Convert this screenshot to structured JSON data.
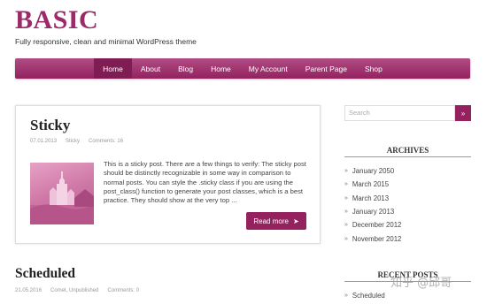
{
  "site": {
    "title": "BASIC",
    "tagline": "Fully responsive, clean and minimal WordPress theme"
  },
  "nav": {
    "items": [
      {
        "label": "Home",
        "active": true
      },
      {
        "label": "About",
        "active": false
      },
      {
        "label": "Blog",
        "active": false
      },
      {
        "label": "Home",
        "active": false
      },
      {
        "label": "My Account",
        "active": false
      },
      {
        "label": "Parent Page",
        "active": false
      },
      {
        "label": "Shop",
        "active": false
      }
    ]
  },
  "post1": {
    "title": "Sticky",
    "date": "07.01.2013",
    "category": "Sticky",
    "comments": "Comments: 16",
    "excerpt": "This is a sticky post. There are a few things to verify: The sticky post should be distinctly recognizable in some way in comparison to normal posts. You can style the .sticky class if you are using the post_class() function to generate your post classes, which is a best practice. They should show at the very top ...",
    "read_more": "Read more",
    "read_more_icon": "arrow-right-icon"
  },
  "post2": {
    "title": "Scheduled",
    "date": "21.05.2016",
    "categories": "Comet, Unpublished",
    "comments": "Comments: 0"
  },
  "sidebar": {
    "search_placeholder": "Search",
    "search_icon": "search-icon",
    "archives_title": "ARCHIVES",
    "archives": [
      "January 2050",
      "March 2015",
      "March 2013",
      "January 2013",
      "December 2012",
      "November 2012"
    ],
    "recent_title": "RECENT POSTS",
    "recent": [
      "Scheduled"
    ]
  },
  "watermark": "知乎 @邱哥",
  "colors": {
    "accent": "#93225f",
    "accent_dark": "#7e1c53",
    "title": "#9c2a68"
  }
}
